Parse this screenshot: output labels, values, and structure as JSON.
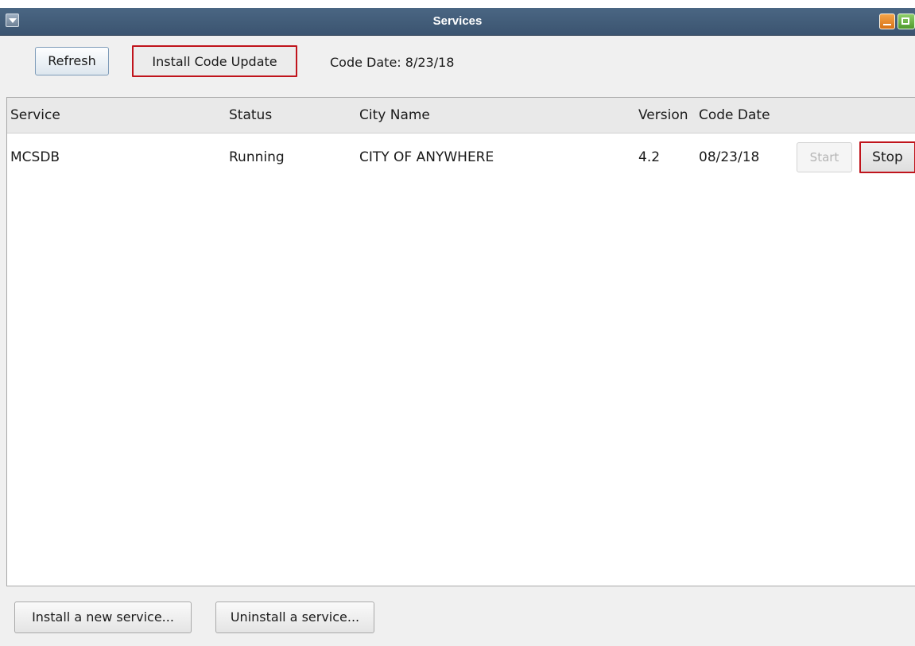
{
  "window": {
    "title": "Services"
  },
  "toolbar": {
    "refresh_label": "Refresh",
    "install_code_update_label": "Install Code Update",
    "code_date_text": "Code Date: 8/23/18"
  },
  "table": {
    "columns": [
      "Service",
      "Status",
      "City Name",
      "Version",
      "Code Date"
    ],
    "rows": [
      {
        "service": "MCSDB",
        "status": "Running",
        "city_name": "CITY OF ANYWHERE",
        "version": "4.2",
        "code_date": "08/23/18",
        "start_label": "Start",
        "stop_label": "Stop"
      }
    ]
  },
  "footer": {
    "install_new_label": "Install a new service...",
    "uninstall_label": "Uninstall a service..."
  },
  "colors": {
    "titlebar": "#3b5470",
    "highlight_border": "#c0141c",
    "minimize": "#e8892e",
    "maximize": "#6ab544"
  },
  "icons": [
    "window-menu-icon",
    "minimize-icon",
    "maximize-icon"
  ]
}
